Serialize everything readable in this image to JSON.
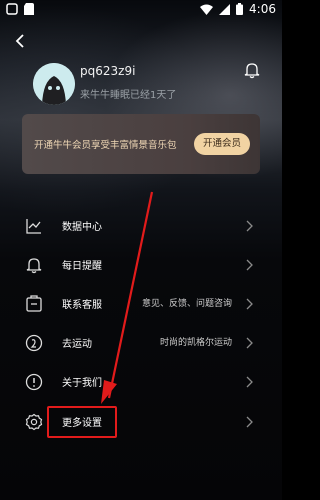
{
  "statusbar": {
    "time": "4:06"
  },
  "profile": {
    "username": "pq623z9i",
    "subtitle": "来牛牛睡眠已经1天了"
  },
  "vip": {
    "text": "开通牛牛会员享受丰富情景音乐包",
    "button": "开通会员"
  },
  "menu": {
    "items": [
      {
        "label": "数据中心",
        "info": "",
        "icon": "chart-icon"
      },
      {
        "label": "每日提醒",
        "info": "",
        "icon": "bell-icon"
      },
      {
        "label": "联系客服",
        "info": "意见、反馈、问题咨询",
        "icon": "service-icon"
      },
      {
        "label": "去运动",
        "info": "时尚的凯格尔运动",
        "icon": "exercise-icon"
      },
      {
        "label": "关于我们",
        "info": "",
        "icon": "info-icon"
      },
      {
        "label": "更多设置",
        "info": "",
        "icon": "settings-icon"
      }
    ]
  },
  "annotation": {
    "color": "#e21b1b"
  }
}
